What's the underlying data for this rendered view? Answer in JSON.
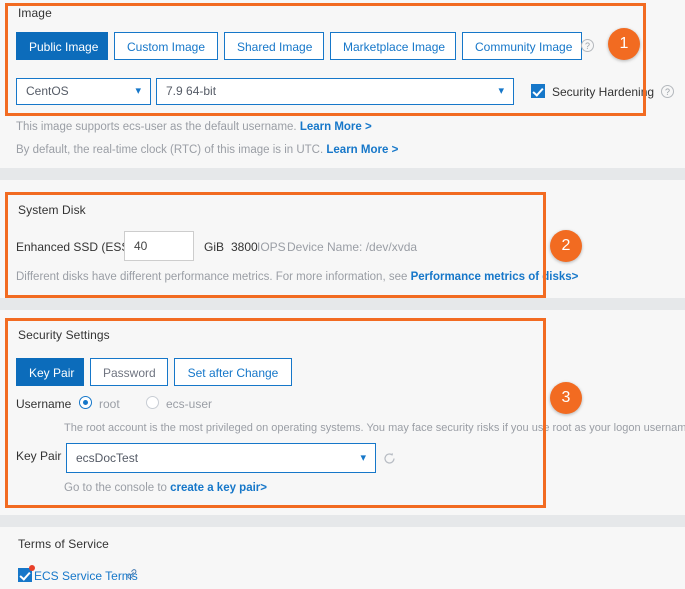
{
  "sections": {
    "image": {
      "title": "Image",
      "badge": "1",
      "tabs": [
        {
          "label": "Public Image",
          "active": true
        },
        {
          "label": "Custom Image",
          "active": false
        },
        {
          "label": "Shared Image",
          "active": false
        },
        {
          "label": "Marketplace Image",
          "active": false
        },
        {
          "label": "Community Image",
          "active": false
        }
      ],
      "help_icon_tabs": "question-mark-icon",
      "os_select": {
        "value": "CentOS",
        "chevron": "chevron-down-icon"
      },
      "version_select": {
        "value": "7.9 64-bit",
        "chevron": "chevron-down-icon"
      },
      "security_hardening": {
        "label": "Security Hardening",
        "checked": true
      },
      "help_icon_hardening": "question-mark-icon",
      "notes": [
        {
          "text": "This image supports ecs-user as the default username. ",
          "link": "Learn More >"
        },
        {
          "text": "By default, the real-time clock (RTC) of this image is in UTC. ",
          "link": "Learn More >"
        }
      ]
    },
    "system_disk": {
      "title": "System Disk",
      "badge": "2",
      "disk_type": "Enhanced SSD (ESSD)",
      "size_value": "40",
      "size_unit": "GiB",
      "iops_value": "3800",
      "iops_unit": "IOPS",
      "device_name": "Device Name: /dev/xvda",
      "note_text": "Different disks have different performance metrics. For more information, see ",
      "note_link": "Performance metrics of disks>"
    },
    "security_settings": {
      "title": "Security Settings",
      "badge": "3",
      "tabs": [
        {
          "label": "Key Pair",
          "active": true
        },
        {
          "label": "Password",
          "active": false
        },
        {
          "label": "Set after Change",
          "active": false
        }
      ],
      "username_label": "Username",
      "username_options": [
        {
          "label": "root",
          "selected": true
        },
        {
          "label": "ecs-user",
          "selected": false
        }
      ],
      "username_note": "The root account is the most privileged on operating systems. You may face security risks if you use root as your logon username.",
      "keypair_label": "Key Pair",
      "keypair_select": {
        "value": "ecsDocTest",
        "chevron": "chevron-down-icon"
      },
      "refresh_icon": "refresh-icon",
      "keypair_note_text": "Go to the console to ",
      "keypair_note_link": "create a key pair>"
    },
    "terms": {
      "title": "Terms of Service",
      "checkbox": {
        "label": "ECS Service Terms",
        "checked": true
      },
      "link_icon": "external-link-icon"
    }
  },
  "colors": {
    "accent_blue": "#0c6cbb",
    "border_blue": "#1677c9",
    "highlight_orange": "#f26b21",
    "page_bg": "#f7f7f7",
    "separator": "#e6e8ea"
  }
}
